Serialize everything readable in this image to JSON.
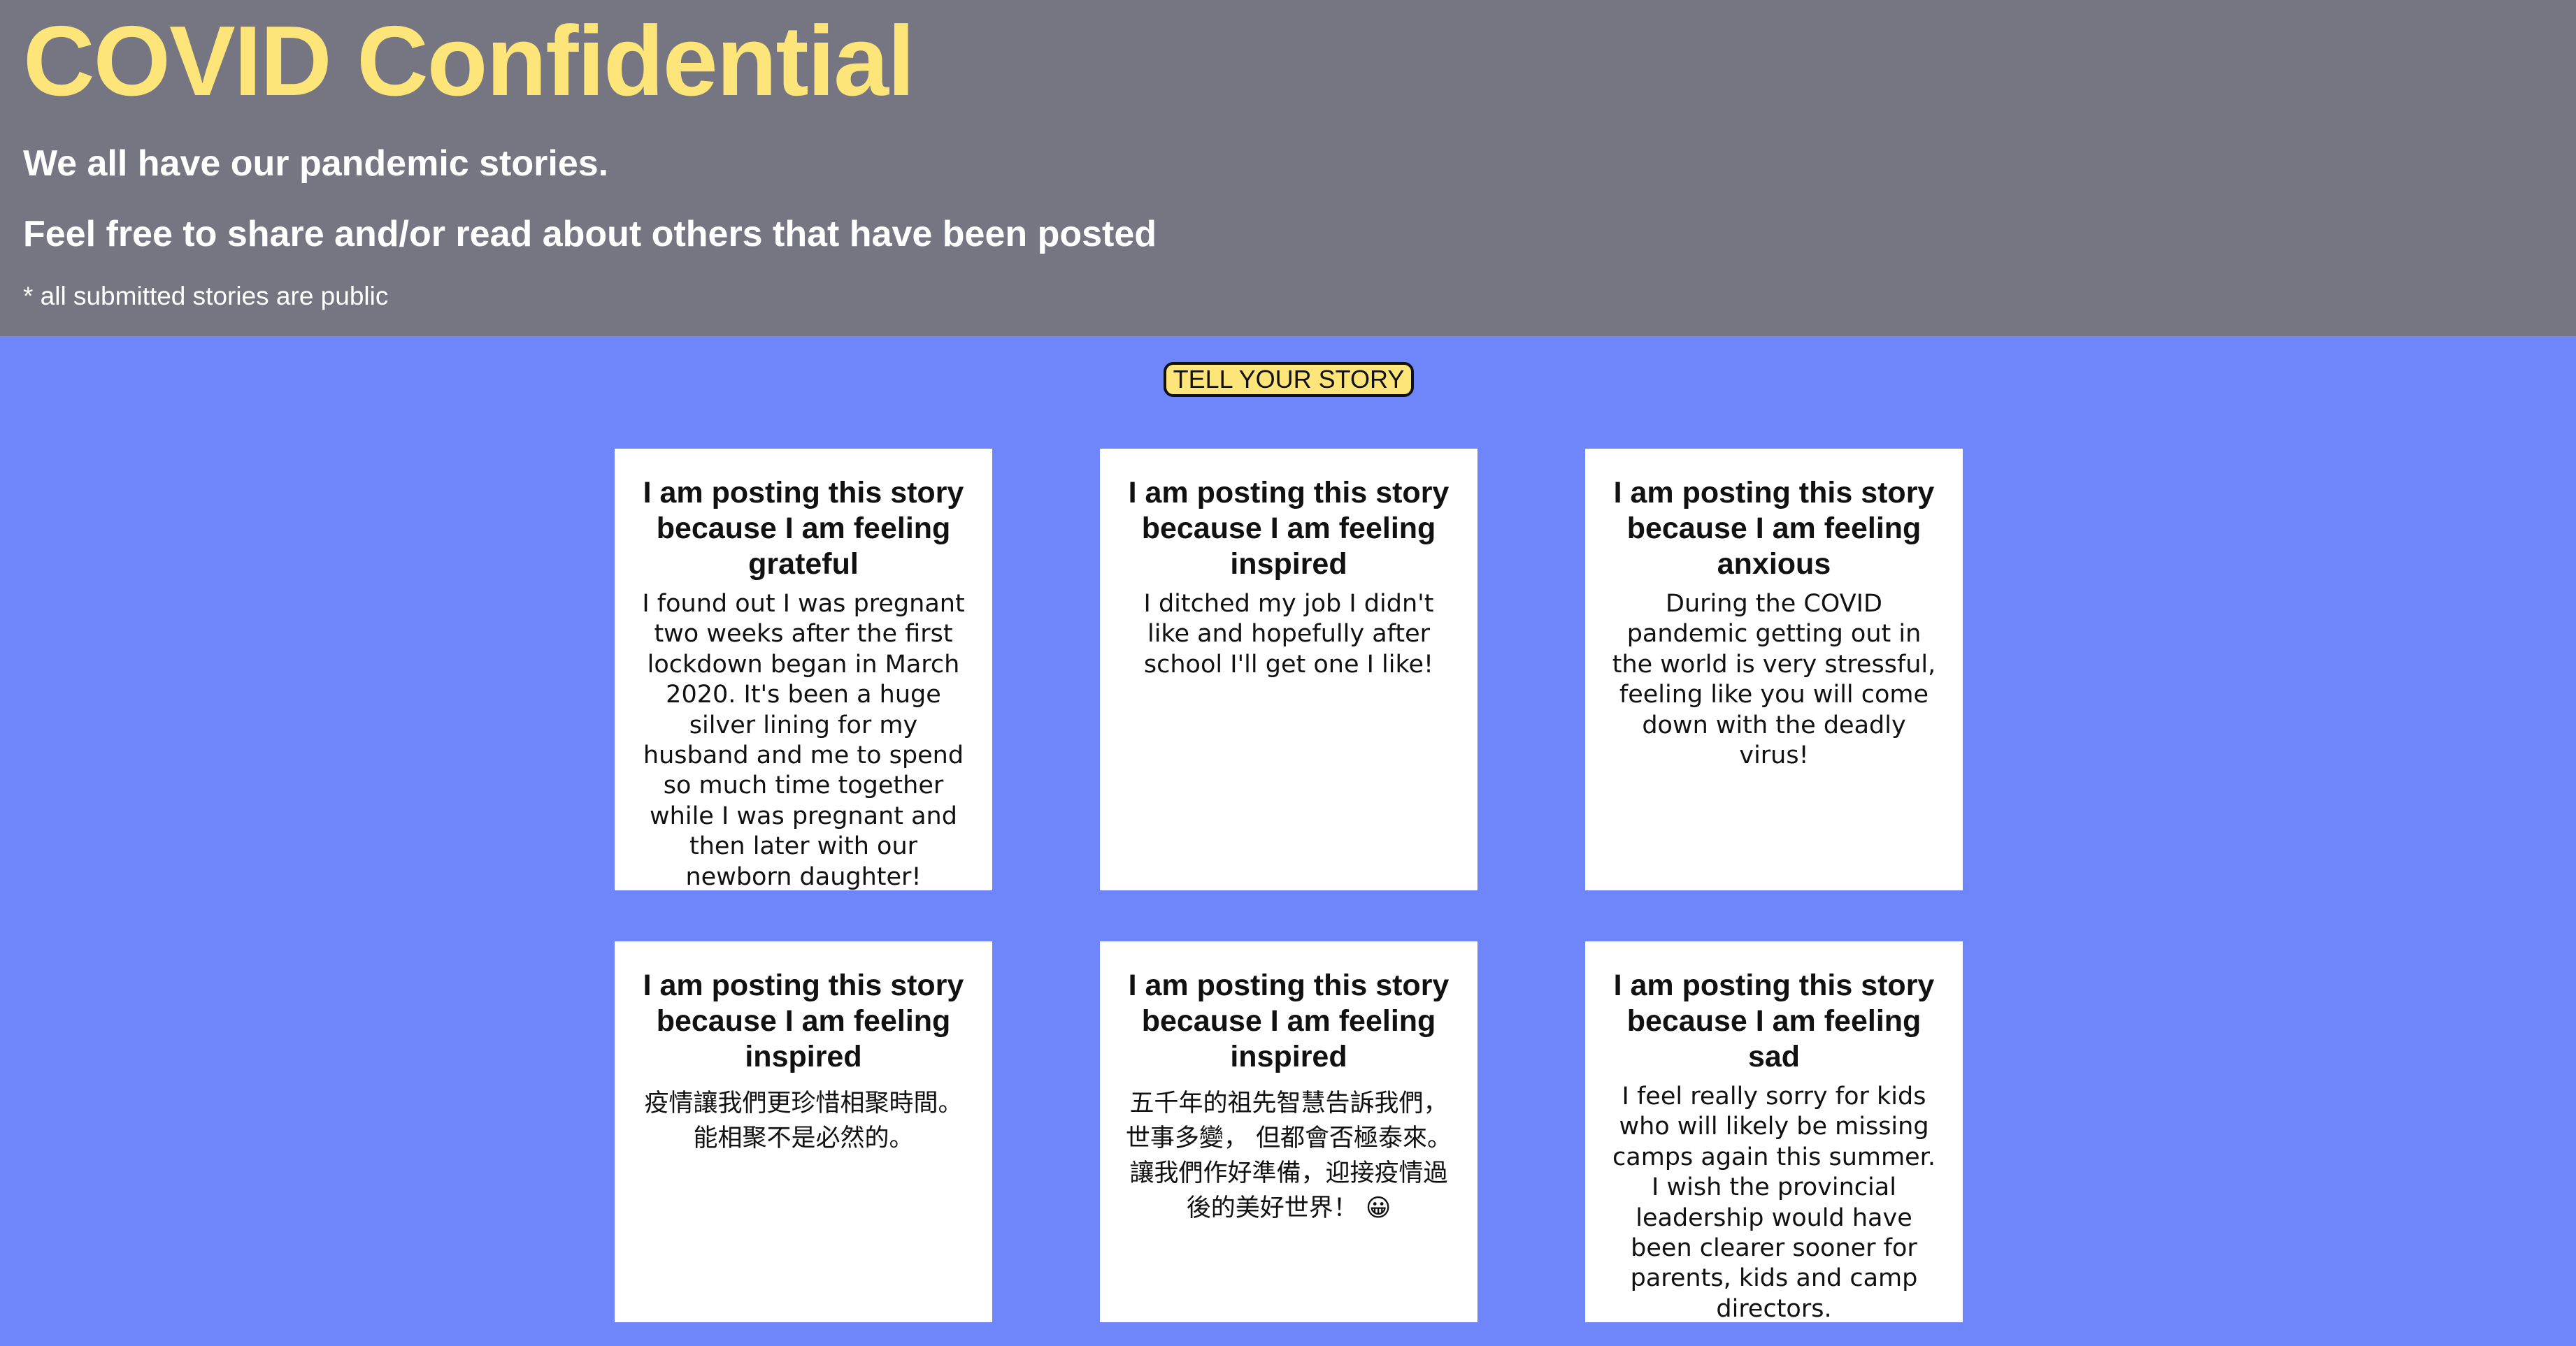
{
  "header": {
    "title": "COVID Confidential",
    "tagline_1": "We all have our pandemic stories.",
    "tagline_2": "Feel free to share and/or read about others that have been posted",
    "note": "* all submitted stories are public"
  },
  "cta": {
    "label": "TELL YOUR STORY"
  },
  "colors": {
    "header_bg": "#767582",
    "page_bg": "#6e86fa",
    "accent_yellow": "#fde57a",
    "card_bg": "#ffffff"
  },
  "stories": [
    {
      "title": "I am posting this story because I am feeling grateful",
      "body": "I found out I was pregnant two weeks after the first lockdown began in March 2020. It's been a huge silver lining for my husband and me to spend so much time together while I was pregnant and then later with our newborn daughter!"
    },
    {
      "title": "I am posting this story because I am feeling inspired",
      "body": "I ditched my job I didn't like and hopefully after school I'll get one I like!"
    },
    {
      "title": "I am posting this story because I am feeling anxious",
      "body": "During the COVID pandemic getting out in the world is very stressful, feeling like you will come down with the deadly virus!"
    },
    {
      "title": "I am posting this story because I am feeling inspired",
      "body": "疫情讓我們更珍惜相聚時間。能相聚不是必然的。"
    },
    {
      "title": "I am posting this story because I am feeling inspired",
      "body": "五千年的祖先智慧告訴我們，世事多變， 但都會否極泰來。讓我們作好準備，迎接疫情過後的美好世界！ 😀"
    },
    {
      "title": "I am posting this story because I am feeling sad",
      "body": "I feel really sorry for kids who will likely be missing camps again this summer. I wish the provincial leadership would have been clearer sooner for parents, kids and camp directors."
    }
  ]
}
